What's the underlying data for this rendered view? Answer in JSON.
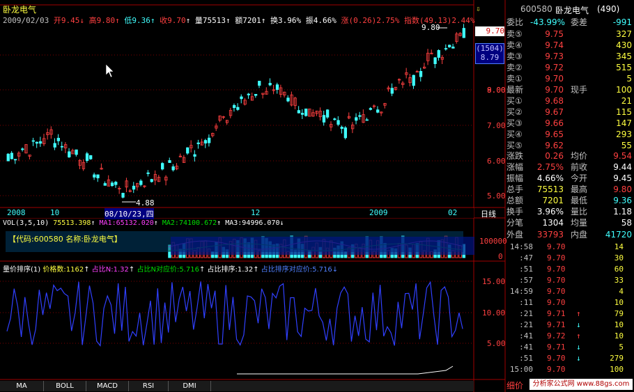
{
  "stock_name": "卧龙电气",
  "header": {
    "date": "2009/02/03",
    "open_label": "开",
    "open": "9.45",
    "high_label": "高",
    "high": "9.80",
    "low_label": "低",
    "low": "9.36",
    "close_label": "收",
    "close": "9.70",
    "vol_label": "量",
    "vol": "75513",
    "amt_label": "额",
    "amt": "7201",
    "turn_label": "换",
    "turn": "3.96%",
    "amp_label": "振",
    "amp": "4.66%",
    "chg_label": "涨",
    "chg": "(0.26)",
    "chg_pct": "2.75%",
    "idx_label": "指数",
    "idx": "(49.13)",
    "idx_pct": "2.44%"
  },
  "price_axis": [
    "9.00",
    "8.00",
    "7.00",
    "6.00",
    "5.00"
  ],
  "price_marks": {
    "current_box": "9.70",
    "sub_box_top": "(1504)",
    "sub_box_bottom": "8.79",
    "high_label": "9.80",
    "low_label": "4.88"
  },
  "date_axis": [
    "2008",
    "10",
    "08/10/23,四",
    "12",
    "2009",
    "02"
  ],
  "day_line_label": "日线",
  "vol_header": {
    "title": "VOL(3,5,10)",
    "vol": "75513.398",
    "ma1_label": "MA1:",
    "ma1": "65132.020",
    "ma2_label": "MA2:",
    "ma2": "74100.672",
    "ma3_label": "MA3:",
    "ma3": "94996.070"
  },
  "vol_axis": [
    "100000",
    "0"
  ],
  "vol_overlay": "【代码:600580 名称:卧龙电气】",
  "ind_header": {
    "title": "量价排序(1)",
    "p1_label": "价格数:",
    "p1": "1162",
    "p2_label": "占比N:",
    "p2": "1.32",
    "p3_label": "占比N对应价:",
    "p3": "5.716",
    "p4_label": "占比排序:",
    "p4": "1.32",
    "p5": "占比排序对应价:5.716"
  },
  "ind_axis": [
    "15.00",
    "10.00",
    "5.00"
  ],
  "tabs": [
    "MA",
    "BOLL",
    "MACD",
    "RSI",
    "DMI"
  ],
  "panel": {
    "code": "600580",
    "name": "卧龙电气",
    "rank": "(490)",
    "wb_label": "委比",
    "wb": "-43.99%",
    "wc_label": "委差",
    "wc": "-991",
    "asks": [
      {
        "label": "卖⑤",
        "price": "9.75",
        "vol": "327"
      },
      {
        "label": "卖④",
        "price": "9.74",
        "vol": "430"
      },
      {
        "label": "卖③",
        "price": "9.73",
        "vol": "345"
      },
      {
        "label": "卖②",
        "price": "9.72",
        "vol": "515"
      },
      {
        "label": "卖①",
        "price": "9.70",
        "vol": "5"
      }
    ],
    "last_label": "最新",
    "last": "9.70",
    "hand_label": "现手",
    "hand": "100",
    "bids": [
      {
        "label": "买①",
        "price": "9.68",
        "vol": "21"
      },
      {
        "label": "买②",
        "price": "9.67",
        "vol": "115"
      },
      {
        "label": "买③",
        "price": "9.66",
        "vol": "147"
      },
      {
        "label": "买④",
        "price": "9.65",
        "vol": "293"
      },
      {
        "label": "买⑤",
        "price": "9.62",
        "vol": "55"
      }
    ],
    "stats": [
      {
        "l1": "涨跌",
        "v1": "0.26",
        "l2": "均价",
        "v2": "9.54"
      },
      {
        "l1": "涨幅",
        "v1": "2.75%",
        "l2": "前收",
        "v2": "9.44"
      },
      {
        "l1": "振幅",
        "v1": "4.66%",
        "l2": "今开",
        "v2": "9.45"
      },
      {
        "l1": "总手",
        "v1": "75513",
        "l2": "最高",
        "v2": "9.80"
      },
      {
        "l1": "总额",
        "v1": "7201",
        "l2": "最低",
        "v2": "9.36"
      },
      {
        "l1": "换手",
        "v1": "3.96%",
        "l2": "量比",
        "v2": "1.18"
      },
      {
        "l1": "分笔",
        "v1": "1304",
        "l2": "均量",
        "v2": "58"
      }
    ],
    "outer_label": "外盘",
    "outer": "33793",
    "inner_label": "内盘",
    "inner": "41720",
    "ticks": [
      {
        "t": "14:58",
        "p": "9.70",
        "d": "",
        "v": "14"
      },
      {
        "t": ":47",
        "p": "9.70",
        "d": "",
        "v": "30"
      },
      {
        "t": ":51",
        "p": "9.70",
        "d": "",
        "v": "60"
      },
      {
        "t": ":57",
        "p": "9.70",
        "d": "",
        "v": "33"
      },
      {
        "t": "14:59",
        "p": "9.70",
        "d": "",
        "v": "4"
      },
      {
        "t": ":11",
        "p": "9.70",
        "d": "",
        "v": "10"
      },
      {
        "t": ":21",
        "p": "9.71",
        "d": "↑",
        "v": "79"
      },
      {
        "t": ":21",
        "p": "9.71",
        "d": "↓",
        "v": "10"
      },
      {
        "t": ":41",
        "p": "9.72",
        "d": "↑",
        "v": "10"
      },
      {
        "t": ":41",
        "p": "9.71",
        "d": "↓",
        "v": "5"
      },
      {
        "t": ":51",
        "p": "9.70",
        "d": "↓",
        "v": "279"
      },
      {
        "t": "15:00",
        "p": "9.70",
        "d": "",
        "v": "100"
      }
    ],
    "detail_label": "细价",
    "watermark": "分析家公式网 www.88gs.com"
  }
}
